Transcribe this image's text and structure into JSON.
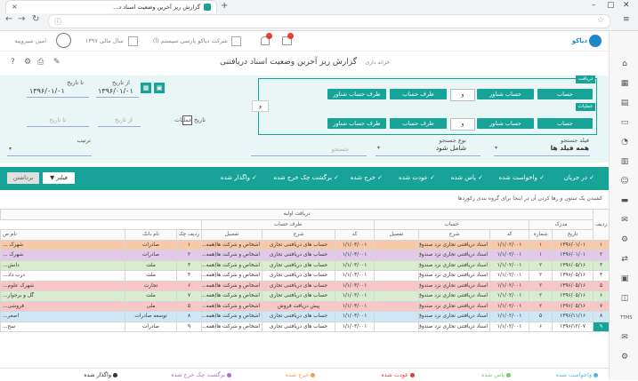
{
  "browser": {
    "tab_title": "گزارش ریز آخرین وضعیت اسناد د...",
    "new_tab": "+",
    "close": "×",
    "nav_back": "←",
    "nav_forward": "→",
    "nav_reload": "↻"
  },
  "app_header": {
    "logo_text": "دیاکو",
    "company": "شرکت دیاکو پارسی سیستم (آ)",
    "fiscal_year": "سال مالی ۱۳۹۷",
    "user": "امین شیروییه",
    "notif_count": "۰",
    "msg_count": "۰"
  },
  "page": {
    "breadcrumb": "خزانه داری",
    "title": "گزارش ریز آخرین وضعیت اسناد دریافتنی"
  },
  "filter": {
    "from_date_label": "از تاریخ",
    "from_date": "۱۳۹۶/۰۱/۰۱",
    "to_date_label": "تا تاریخ",
    "to_date": "۱۳۹۶/۰۱/۰۱",
    "op_date_label": "تاریخ عملیات",
    "from_placeholder": "از تاریخ",
    "to_placeholder": "تا تاریخ",
    "receive_label": "دریافت",
    "operations_label": "عملیات",
    "and_label": "و",
    "row1_buttons": [
      "حساب",
      "حساب شناور",
      "طرف حساب",
      "طرف حساب شناور"
    ],
    "row2_buttons": [
      "حساب",
      "حساب شناور",
      "طرف حساب",
      "طرف حساب شناور"
    ],
    "search_fields_label": "فیلد جستجو",
    "search_fields_value": "همه فیلد ها",
    "search_type_label": "نوع جستجو",
    "search_type_value": "شامل شود",
    "search_placeholder": "جستجو",
    "sort_label": "ترتیب"
  },
  "statuses": [
    "در جریان",
    "واخواست شده",
    "پاس شده",
    "عودت شده",
    "خرج شده",
    "برگشت چک خرج شده",
    "واگذار شده"
  ],
  "actions": {
    "filter": "فیلتر",
    "clear": "برداشتن"
  },
  "group_hint": "کشیدن یک ستون و رها کردن آن در اینجا برای گروه بندی رکوردها",
  "table": {
    "group_header": "دریافت اولیه",
    "sub_headers": {
      "row": "ردیف",
      "doc": "مدرک",
      "account": "حساب",
      "party": "طرف حساب"
    },
    "columns": {
      "row": "ردیف",
      "date": "تاریخ",
      "number": "شماره",
      "acc_code": "کد",
      "acc_desc": "شرح",
      "acc_detail": "تفصیل",
      "party_code": "کد",
      "party_desc": "شرح",
      "party_detail": "تفصیل",
      "cheque_row": "ردیف چک",
      "bank": "نام بانک",
      "owner": "نام ص"
    },
    "rows": [
      {
        "row": "۱",
        "date": "۱۳۹۶/۰۱/۰۱",
        "number": "۱",
        "acc_code": "۱/۱/۰۲/۰۰۱",
        "acc_desc": "اسناد دریافتنی تجاری نزد صندوق",
        "acc_detail": "",
        "party_code": "۱/۱/۰۳/۰۰۱",
        "party_desc": "حساب های دریافتنی تجاری",
        "party_detail": "اشخاص و شرکت ها(همه...",
        "cheque_row": "۱",
        "bank": "صادرات",
        "owner": "شهرک ...",
        "color": "#f7c9a9"
      },
      {
        "row": "۲",
        "date": "۱۳۹۶/۰۱/۰۱",
        "number": "۱",
        "acc_code": "۱/۱/۰۲/۰۰۱",
        "acc_desc": "اسناد دریافتنی تجاری نزد صندوق",
        "acc_detail": "",
        "party_code": "۱/۱/۰۳/۰۰۱",
        "party_desc": "حساب های دریافتنی تجاری",
        "party_detail": "اشخاص و شرکت ها(همه...",
        "cheque_row": "۲",
        "bank": "صادرات",
        "owner": "شهرک ...",
        "color": "#e2c9ea"
      },
      {
        "row": "۳",
        "date": "۱۳۹۶/۰۵/۱۶",
        "number": "۲",
        "acc_code": "۱/۱/۰۲/۰۰۱",
        "acc_desc": "اسناد دریافتنی تجاری نزد صندوق",
        "acc_detail": "",
        "party_code": "۱/۱/۰۳/۰۰۱",
        "party_desc": "حساب های دریافتنی تجاری",
        "party_detail": "اشخاص و شرکت ها(همه...",
        "cheque_row": "۳",
        "bank": "ملت",
        "owner": "دانش...",
        "color": "#d9ecd0"
      },
      {
        "row": "۴",
        "date": "۱۳۹۶/۰۵/۱۶",
        "number": "۲",
        "acc_code": "۱/۱/۰۲/۰۰۱",
        "acc_desc": "اسناد دریافتنی تجاری نزد صندوق",
        "acc_detail": "",
        "party_code": "۱/۱/۰۳/۰۰۱",
        "party_desc": "حساب های دریافتنی تجاری",
        "party_detail": "اشخاص و شرکت ها(همه...",
        "cheque_row": "۴",
        "bank": "ملت",
        "owner": "درب داد...",
        "color": "#ffffff"
      },
      {
        "row": "۵",
        "date": "۱۳۹۶/۰۵/۱۶",
        "number": "۲",
        "acc_code": "۱/۱/۰۲/۰۰۱",
        "acc_desc": "اسناد دریافتنی تجاری نزد صندوق",
        "acc_detail": "",
        "party_code": "۱/۱/۰۳/۰۰۱",
        "party_desc": "حساب های دریافتنی تجاری",
        "party_detail": "اشخاص و شرکت ها(همه...",
        "cheque_row": "۶",
        "bank": "تجارت",
        "owner": "شهرک علوم...",
        "color": "#f8c6c6"
      },
      {
        "row": "۶",
        "date": "۱۳۹۶/۰۵/۱۶",
        "number": "۲",
        "acc_code": "۱/۱/۰۲/۰۰۱",
        "acc_desc": "اسناد دریافتنی تجاری نزد صندوق",
        "acc_detail": "",
        "party_code": "۱/۱/۰۳/۰۰۱",
        "party_desc": "حساب های دریافتنی تجاری",
        "party_detail": "اشخاص و شرکت ها(همه...",
        "cheque_row": "۷",
        "bank": "ملت",
        "owner": "گل و برجوار...",
        "color": "#d9ecd0"
      },
      {
        "row": "۷",
        "date": "۱۳۹۶/۰۵/۱۶",
        "number": "۲",
        "acc_code": "۱/۱/۰۲/۰۰۱",
        "acc_desc": "اسناد دریافتنی تجاری نزد صندوق",
        "acc_detail": "",
        "party_code": "۱/۱/۰۳/۰۰۱",
        "party_desc": "پیش دریافت فروش",
        "party_detail": "اشخاص و شرکت ها(همه...",
        "cheque_row": "۵",
        "bank": "ملی",
        "owner": "فروشی...",
        "color": "#f8c6c6"
      },
      {
        "row": "۸",
        "date": "۱۳۹۶/۱۱/۱۶",
        "number": "۵",
        "acc_code": "۱/۱/۰۲/۰۰۱",
        "acc_desc": "اسناد دریافتنی تجاری نزد صندوق",
        "acc_detail": "",
        "party_code": "۱/۱/۰۳/۰۰۱",
        "party_desc": "حساب های دریافتنی تجاری",
        "party_detail": "اشخاص و شرکت ها(همه...",
        "cheque_row": "۸",
        "bank": "توسعه صادرات",
        "owner": "اصغر...",
        "color": "#cfe6f7"
      },
      {
        "row": "۹",
        "date": "۱۳۹۶/۱۲/۰۷",
        "number": "۶",
        "acc_code": "۱/۱/۰۲/۰۰۱",
        "acc_desc": "اسناد دریافتنی تجاری نزد صندوق",
        "acc_detail": "",
        "party_code": "۱/۱/۰۳/۰۰۱",
        "party_desc": "حساب های دریافتنی تجاری",
        "party_detail": "اشخاص و شرکت ها(همه...",
        "cheque_row": "۹",
        "bank": "صادرات",
        "owner": "سح...",
        "color": "#ffffff"
      }
    ]
  },
  "legend": [
    {
      "label": "واخواست شده",
      "color": "#4fb3e8"
    },
    {
      "label": "پاس شده",
      "color": "#7bc96f"
    },
    {
      "label": "عودت شده",
      "color": "#e53935"
    },
    {
      "label": "خرج شده",
      "color": "#f39c4a"
    },
    {
      "label": "برگشت چک خرج شده",
      "color": "#b06ad0"
    },
    {
      "label": "واگذار شده",
      "color": "#333333"
    }
  ],
  "colors": {
    "accent": "#17a398"
  }
}
